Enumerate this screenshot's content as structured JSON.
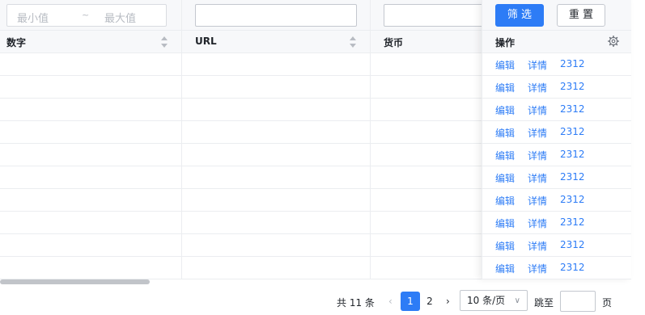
{
  "filters": {
    "range_min_placeholder": "最小值",
    "range_sep": "~",
    "range_max_placeholder": "最大值"
  },
  "columns": {
    "number": "数字",
    "url": "URL",
    "currency": "货币",
    "actions": "操作"
  },
  "buttons": {
    "filter": "筛 选",
    "reset": "重 置"
  },
  "row_actions": [
    {
      "edit": "编辑",
      "detail": "详情",
      "extra": "2312"
    },
    {
      "edit": "编辑",
      "detail": "详情",
      "extra": "2312"
    },
    {
      "edit": "编辑",
      "detail": "详情",
      "extra": "2312"
    },
    {
      "edit": "编辑",
      "detail": "详情",
      "extra": "2312"
    },
    {
      "edit": "编辑",
      "detail": "详情",
      "extra": "2312"
    },
    {
      "edit": "编辑",
      "detail": "详情",
      "extra": "2312"
    },
    {
      "edit": "编辑",
      "detail": "详情",
      "extra": "2312"
    },
    {
      "edit": "编辑",
      "detail": "详情",
      "extra": "2312"
    },
    {
      "edit": "编辑",
      "detail": "详情",
      "extra": "2312"
    },
    {
      "edit": "编辑",
      "detail": "详情",
      "extra": "2312"
    }
  ],
  "pagination": {
    "total": "共 11 条",
    "pages": [
      "1",
      "2"
    ],
    "current": "1",
    "page_size": "10 条/页",
    "goto_label": "跳至",
    "page_label": "页"
  },
  "icons": {
    "sort": "sort-icon",
    "settings": "gear-icon",
    "prev": "chevron-left-icon",
    "next": "chevron-right-icon",
    "dropdown": "chevron-down-icon"
  },
  "colors": {
    "primary": "#2d7cf6",
    "header_bg": "#f7f8fa",
    "border": "#ebedf0"
  }
}
